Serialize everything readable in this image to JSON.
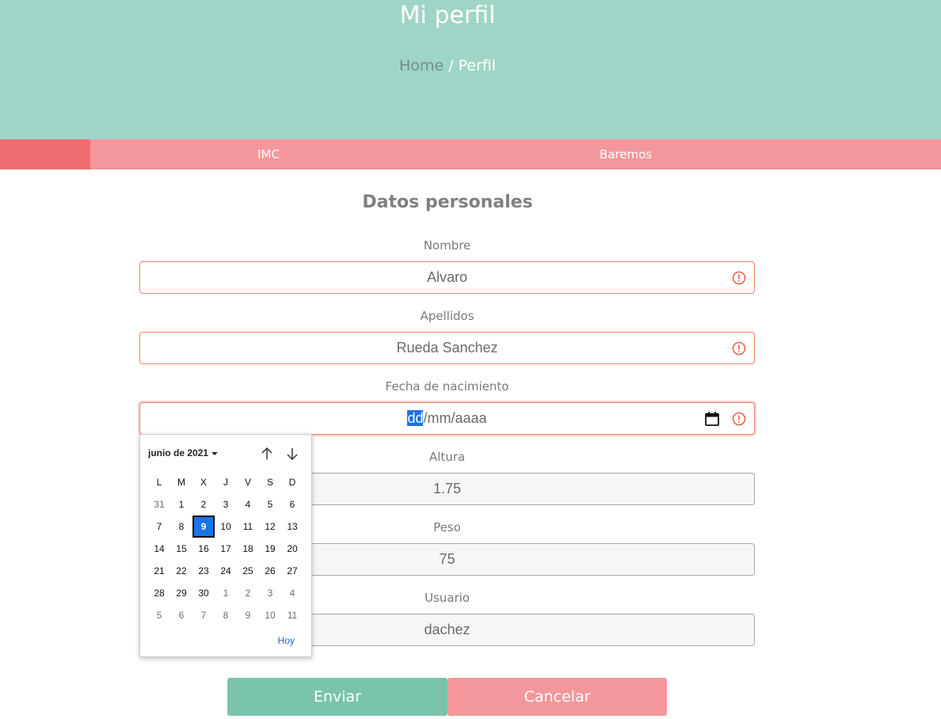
{
  "header": {
    "title": "Mi perfil",
    "breadcrumb": {
      "home": "Home",
      "separator": "/",
      "current": "Perfil"
    }
  },
  "nav": {
    "items": [
      "IMC",
      "Baremos"
    ]
  },
  "form": {
    "section_title": "Datos personales",
    "nombre": {
      "label": "Nombre",
      "value": "Alvaro"
    },
    "apellidos": {
      "label": "Apellidos",
      "value": "Rueda Sanchez"
    },
    "fecha": {
      "label": "Fecha de nacimiento",
      "seg_day": "dd",
      "seg_rest": "/mm/aaaa"
    },
    "altura": {
      "label": "Altura",
      "value": "1.75"
    },
    "peso": {
      "label": "Peso",
      "value": "75"
    },
    "usuario": {
      "label": "Usuario",
      "value": "dachez"
    },
    "submit_label": "Enviar",
    "cancel_label": "Cancelar"
  },
  "datepicker": {
    "month_label": "junio de 2021",
    "weekdays": [
      "L",
      "M",
      "X",
      "J",
      "V",
      "S",
      "D"
    ],
    "weeks": [
      [
        {
          "d": "31",
          "o": true
        },
        {
          "d": "1"
        },
        {
          "d": "2"
        },
        {
          "d": "3"
        },
        {
          "d": "4"
        },
        {
          "d": "5"
        },
        {
          "d": "6"
        }
      ],
      [
        {
          "d": "7"
        },
        {
          "d": "8"
        },
        {
          "d": "9",
          "s": true
        },
        {
          "d": "10"
        },
        {
          "d": "11"
        },
        {
          "d": "12"
        },
        {
          "d": "13"
        }
      ],
      [
        {
          "d": "14"
        },
        {
          "d": "15"
        },
        {
          "d": "16"
        },
        {
          "d": "17"
        },
        {
          "d": "18"
        },
        {
          "d": "19"
        },
        {
          "d": "20"
        }
      ],
      [
        {
          "d": "21"
        },
        {
          "d": "22"
        },
        {
          "d": "23"
        },
        {
          "d": "24"
        },
        {
          "d": "25"
        },
        {
          "d": "26"
        },
        {
          "d": "27"
        }
      ],
      [
        {
          "d": "28"
        },
        {
          "d": "29"
        },
        {
          "d": "30"
        },
        {
          "d": "1",
          "o": true
        },
        {
          "d": "2",
          "o": true
        },
        {
          "d": "3",
          "o": true
        },
        {
          "d": "4",
          "o": true
        }
      ],
      [
        {
          "d": "5",
          "o": true
        },
        {
          "d": "6",
          "o": true
        },
        {
          "d": "7",
          "o": true
        },
        {
          "d": "8",
          "o": true
        },
        {
          "d": "9",
          "o": true
        },
        {
          "d": "10",
          "o": true
        },
        {
          "d": "11",
          "o": true
        }
      ]
    ],
    "today_label": "Hoy"
  },
  "colors": {
    "header_bg": "#9fd5c6",
    "nav_bg": "#f4979a",
    "nav_active": "#f06d72",
    "error_border": "#f0826c",
    "submit_bg": "#7ac3ad",
    "cancel_bg": "#f4979a",
    "selection": "#1a73e8"
  },
  "icons": {
    "error": "exclamation-circle-icon",
    "calendar": "calendar-icon",
    "prev": "arrow-up-icon",
    "next": "arrow-down-icon"
  }
}
